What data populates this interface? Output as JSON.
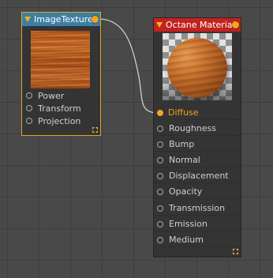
{
  "nodes": {
    "image_texture": {
      "title": "ImageTexture",
      "header_color": "#3d7fa3",
      "accent_color": "#e0a423",
      "inputs": [
        "Power",
        "Transform",
        "Projection"
      ]
    },
    "octane_material": {
      "title": "Octane Material",
      "header_color": "#c2231f",
      "inputs": [
        "Diffuse",
        "Roughness",
        "Bump",
        "Normal",
        "Displacement",
        "Opacity",
        "Transmission",
        "Emission",
        "Medium"
      ],
      "connected_input": "Diffuse"
    }
  },
  "colors": {
    "background": "#494949",
    "port_connected": "#f4a51f",
    "wire": "#d8d8d8"
  },
  "icons": [
    "collapse-arrow-icon",
    "output-port-icon",
    "input-port-icon",
    "resize-handle-icon"
  ]
}
